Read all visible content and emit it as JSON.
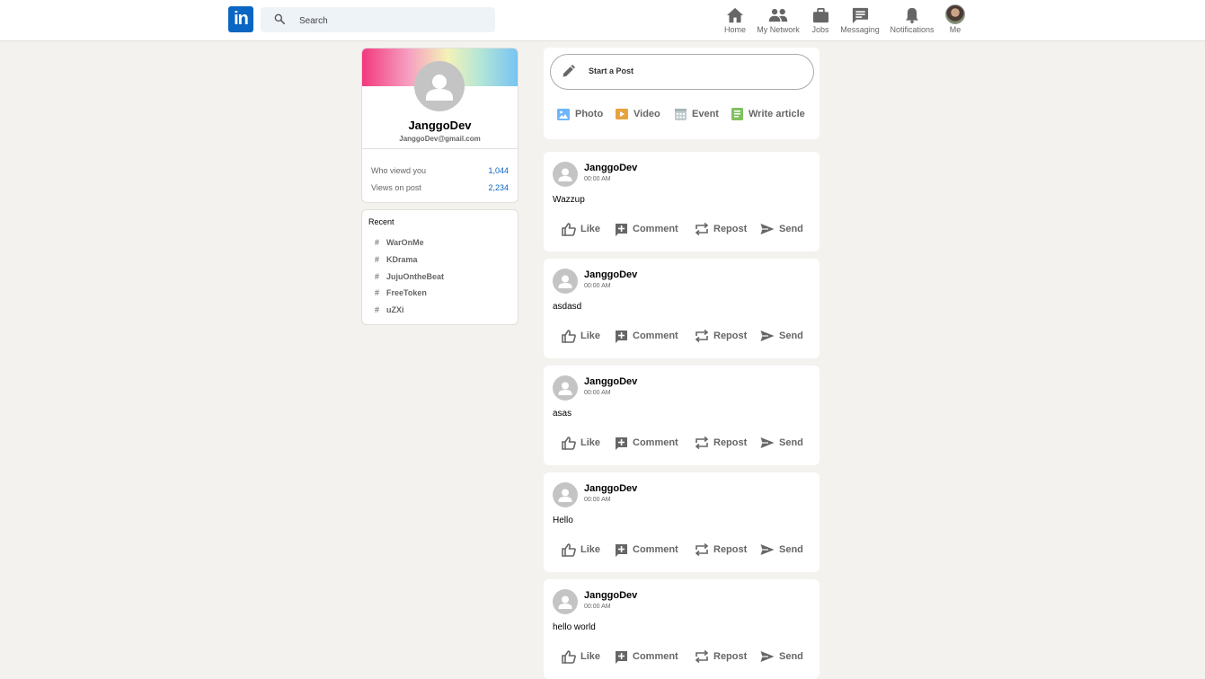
{
  "header": {
    "logo_text": "in",
    "search": {
      "placeholder": "Search"
    },
    "nav": [
      {
        "label": "Home",
        "icon": "home-icon"
      },
      {
        "label": "My Network",
        "icon": "network-icon"
      },
      {
        "label": "Jobs",
        "icon": "briefcase-icon"
      },
      {
        "label": "Messaging",
        "icon": "message-icon"
      },
      {
        "label": "Notifications",
        "icon": "bell-icon"
      },
      {
        "label": "Me",
        "icon": "avatar"
      }
    ]
  },
  "profile": {
    "name": "JanggoDev",
    "email": "JanggoDev@gmail.com",
    "stats": [
      {
        "label": "Who viewd you",
        "value": "1,044"
      },
      {
        "label": "Views on post",
        "value": "2,234"
      }
    ]
  },
  "recent": {
    "title": "Recent",
    "tags": [
      "WarOnMe",
      "KDrama",
      "JujuOntheBeat",
      "FreeToken",
      "uZXi"
    ],
    "hash": "#"
  },
  "composer": {
    "placeholder": "Start a Post",
    "actions": [
      {
        "label": "Photo",
        "icon": "photo-icon",
        "color": "#70b5f9"
      },
      {
        "label": "Video",
        "icon": "video-icon",
        "color": "#e7a33e"
      },
      {
        "label": "Event",
        "icon": "calendar-icon",
        "color": "#c0cbcd"
      },
      {
        "label": "Write article",
        "icon": "article-icon",
        "color": "#7fc15e"
      }
    ]
  },
  "post_actions": [
    "Like",
    "Comment",
    "Repost",
    "Send"
  ],
  "posts": [
    {
      "author": "JanggoDev",
      "time": "00:00 AM",
      "body": "Wazzup"
    },
    {
      "author": "JanggoDev",
      "time": "00:00 AM",
      "body": "asdasd"
    },
    {
      "author": "JanggoDev",
      "time": "00:00 AM",
      "body": "asas"
    },
    {
      "author": "JanggoDev",
      "time": "00:00 AM",
      "body": "Hello"
    },
    {
      "author": "JanggoDev",
      "time": "00:00 AM",
      "body": "hello world"
    }
  ]
}
